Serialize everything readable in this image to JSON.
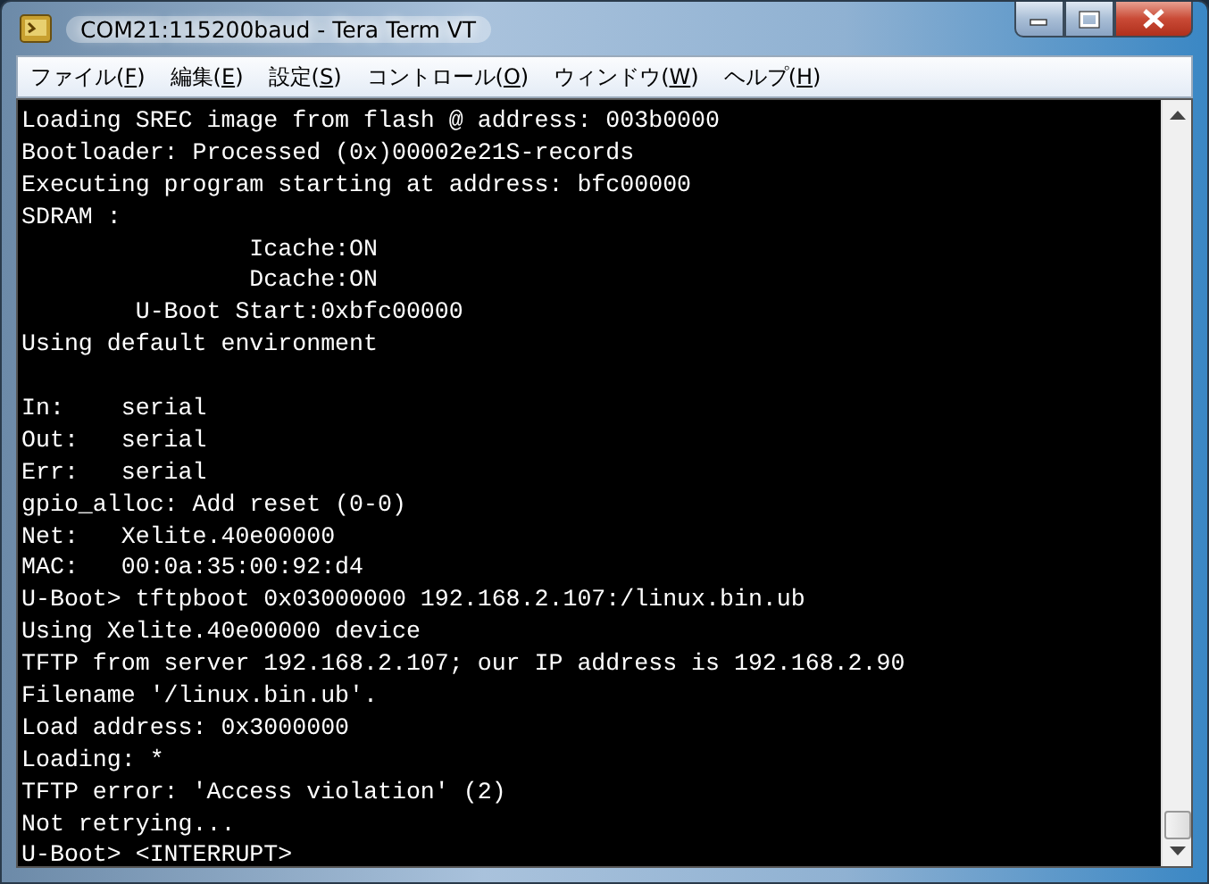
{
  "window": {
    "title": "COM21:115200baud - Tera Term VT"
  },
  "menu": [
    {
      "label": "ファイル(F)"
    },
    {
      "label": "編集(E)"
    },
    {
      "label": "設定(S)"
    },
    {
      "label": "コントロール(O)"
    },
    {
      "label": "ウィンドウ(W)"
    },
    {
      "label": "ヘルプ(H)"
    }
  ],
  "terminal": {
    "lines": [
      {
        "kind": "text",
        "text": "Loading SREC image from flash @ address: 003b0000"
      },
      {
        "kind": "text",
        "text": "Bootloader: Processed (0x)00002e21S-records"
      },
      {
        "kind": "text",
        "text": "Executing program starting at address: bfc00000"
      },
      {
        "kind": "text",
        "text": "SDRAM :"
      },
      {
        "kind": "text",
        "text": "                Icache:ON"
      },
      {
        "kind": "text",
        "text": "                Dcache:ON"
      },
      {
        "kind": "text",
        "text": "        U-Boot Start:0xbfc00000"
      },
      {
        "kind": "text",
        "text": "Using default environment"
      },
      {
        "kind": "blank"
      },
      {
        "kind": "text",
        "text": "In:    serial"
      },
      {
        "kind": "text",
        "text": "Out:   serial"
      },
      {
        "kind": "text",
        "text": "Err:   serial"
      },
      {
        "kind": "text",
        "text": "gpio_alloc: Add reset (0-0)"
      },
      {
        "kind": "text",
        "text": "Net:   Xelite.40e00000"
      },
      {
        "kind": "text",
        "text": "MAC:   00:0a:35:00:92:d4"
      },
      {
        "kind": "text",
        "text": "U-Boot> tftpboot 0x03000000 192.168.2.107:/linux.bin.ub"
      },
      {
        "kind": "text",
        "text": "Using Xelite.40e00000 device"
      },
      {
        "kind": "text",
        "text": "TFTP from server 192.168.2.107; our IP address is 192.168.2.90"
      },
      {
        "kind": "text",
        "text": "Filename '/linux.bin.ub'."
      },
      {
        "kind": "text",
        "text": "Load address: 0x3000000"
      },
      {
        "kind": "text",
        "text": "Loading: *"
      },
      {
        "kind": "text",
        "text": "TFTP error: 'Access violation' (2)"
      },
      {
        "kind": "text",
        "text": "Not retrying..."
      },
      {
        "kind": "text",
        "text": "U-Boot> <INTERRUPT>"
      }
    ]
  }
}
